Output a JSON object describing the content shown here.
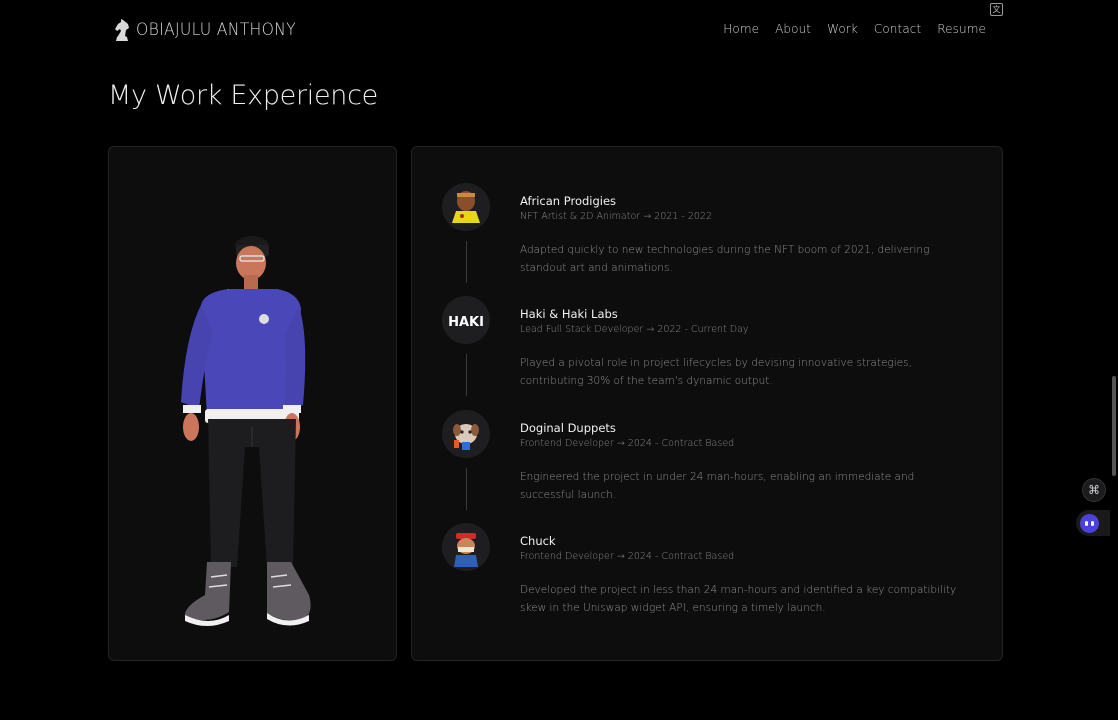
{
  "header": {
    "logo_text": "OBIAJULU ANTHONY",
    "logo_icon": "knight-chess-icon",
    "nav": [
      {
        "label": "Home"
      },
      {
        "label": "About"
      },
      {
        "label": "Work"
      },
      {
        "label": "Contact"
      },
      {
        "label": "Resume"
      }
    ],
    "translate_icon": "translate-icon"
  },
  "main": {
    "heading": "My Work Experience",
    "avatar_alt": "3D avatar of developer",
    "experience": [
      {
        "company": "African Prodigies",
        "meta": "NFT Artist & 2D Animator → 2021 - 2022",
        "description": "Adapted quickly to new technologies during the NFT boom of 2021, delivering standout art and animations.",
        "icon": "african-prodigies-logo"
      },
      {
        "company": "Haki & Haki Labs",
        "meta": "Lead Full Stack Developer → 2022 - Current Day",
        "description": "Played a pivotal role in project lifecycles by devising innovative strategies, contributing 30% of the team's dynamic output.",
        "icon": "haki-logo",
        "logo_text": "HAKI"
      },
      {
        "company": "Doginal Duppets",
        "meta": "Frontend Developer → 2024 - Contract Based",
        "description": "Engineered the project in under 24 man-hours, enabling an immediate and successful launch.",
        "icon": "doginal-duppets-logo"
      },
      {
        "company": "Chuck",
        "meta": "Frontend Developer → 2024 - Contract Based",
        "description": "Developed the project in less than 24 man-hours and identified a key compatibility skew in the Uniswap widget API, ensuring a timely launch.",
        "icon": "chuck-logo"
      }
    ]
  },
  "widgets": {
    "command_glyph": "⌘",
    "command_icon": "command-icon",
    "bot_icon": "chat-bot-icon"
  },
  "colors": {
    "background": "#000000",
    "card": "#0d0d0e",
    "sweater": "#4a48b8"
  }
}
